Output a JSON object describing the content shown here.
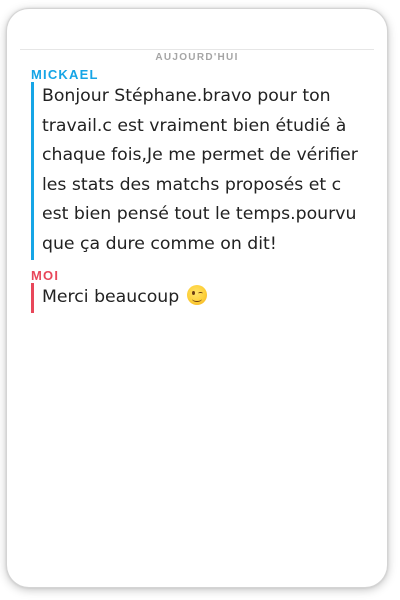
{
  "conversation": {
    "date_label": "AUJOURD'HUI",
    "messages": [
      {
        "sender": "MICKAEL",
        "sender_color": "#16a5e6",
        "bar_color": "#16a5e6",
        "text": "Bonjour Stéphane.bravo pour ton\ntravail.c est vraiment bien étudié à\nchaque fois,Je me permet de vérifier\nles stats  des matchs proposés et c\nest bien pensé tout le temps.pourvu\nque ça dure comme on dit!"
      },
      {
        "sender": "MOI",
        "sender_color": "#e8475a",
        "bar_color": "#e8475a",
        "text": "Merci beaucoup ",
        "emoji": "winking-face-icon"
      }
    ]
  }
}
